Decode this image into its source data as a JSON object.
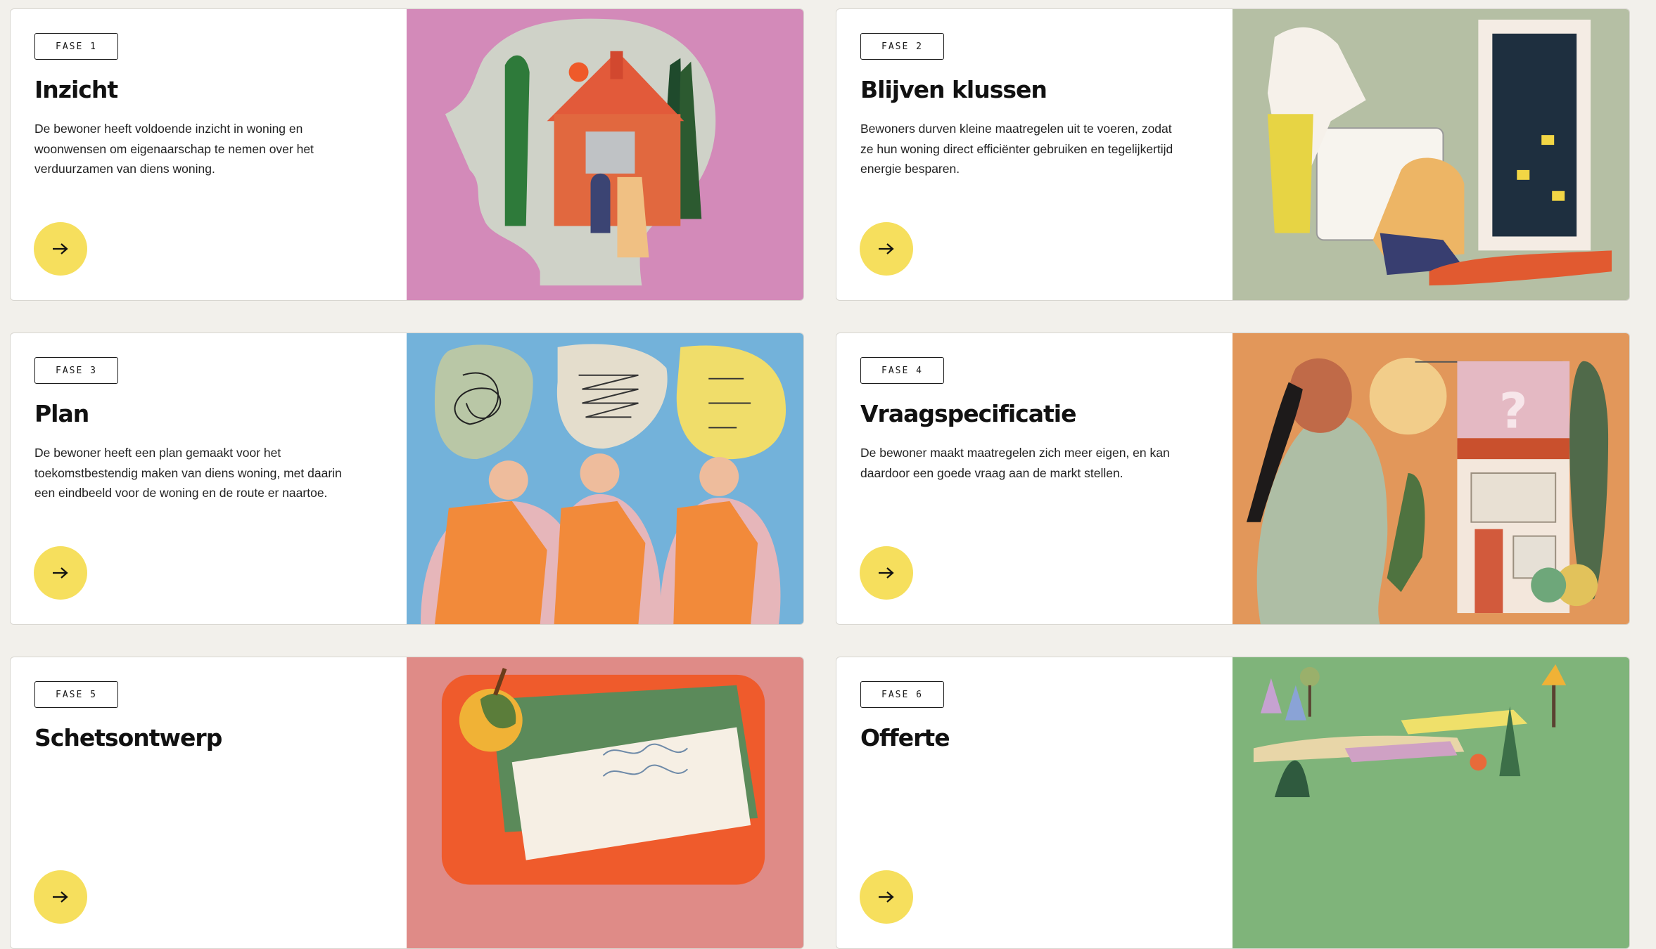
{
  "cards": [
    {
      "phase": "FASE 1",
      "title": "Inzicht",
      "description": "De bewoner heeft voldoende inzicht in woning en woonwensen om eigenaarschap te nemen over het verduurzamen van diens woning.",
      "image_bg": "#d38ab9",
      "arrow_icon": "arrow-right-icon"
    },
    {
      "phase": "FASE 2",
      "title": "Blijven klussen",
      "description": "Bewoners durven kleine maatregelen uit te voeren, zodat ze hun woning direct efficiënter gebruiken en tegelijkertijd energie besparen.",
      "image_bg": "#b5bfa4",
      "arrow_icon": "arrow-right-icon"
    },
    {
      "phase": "FASE 3",
      "title": "Plan",
      "description": "De bewoner heeft een plan gemaakt voor het toekomstbestendig maken van diens woning, met daarin een eindbeeld voor de woning en de route er naartoe.",
      "image_bg": "#73b2da",
      "arrow_icon": "arrow-right-icon"
    },
    {
      "phase": "FASE 4",
      "title": "Vraagspecificatie",
      "description": "De bewoner maakt maatregelen zich meer eigen, en kan daardoor een goede vraag aan de markt stellen.",
      "image_bg": "#e2975a",
      "arrow_icon": "arrow-right-icon"
    },
    {
      "phase": "FASE 5",
      "title": "Schetsontwerp",
      "description": "",
      "image_bg": "#df8b87",
      "arrow_icon": "arrow-right-icon"
    },
    {
      "phase": "FASE 6",
      "title": "Offerte",
      "description": "",
      "image_bg": "#7fb47a",
      "arrow_icon": "arrow-right-icon"
    }
  ],
  "colors": {
    "page_bg": "#f2f0eb",
    "button_yellow": "#f6df5d",
    "text": "#111111"
  }
}
